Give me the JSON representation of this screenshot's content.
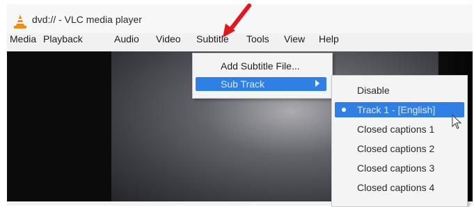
{
  "window": {
    "title": "dvd:// - VLC media player",
    "icon": "vlc-cone-icon"
  },
  "menubar": {
    "items": [
      {
        "label": "Media"
      },
      {
        "label": "Playback"
      },
      {
        "label": "Audio"
      },
      {
        "label": "Video"
      },
      {
        "label": "Subtitle"
      },
      {
        "label": "Tools"
      },
      {
        "label": "View"
      },
      {
        "label": "Help"
      }
    ]
  },
  "subtitle_menu": {
    "items": [
      {
        "label": "Add Subtitle File..."
      },
      {
        "label": "Sub Track",
        "highlighted": true,
        "has_submenu": true
      }
    ]
  },
  "sub_track_menu": {
    "items": [
      {
        "label": "Disable"
      },
      {
        "label": "Track 1 - [English]",
        "selected": true
      },
      {
        "label": "Closed captions 1"
      },
      {
        "label": "Closed captions 2"
      },
      {
        "label": "Closed captions 3"
      },
      {
        "label": "Closed captions 4"
      }
    ]
  },
  "colors": {
    "highlight": "#2f7fe4",
    "annotation_arrow": "#e3161b",
    "vlc_orange": "#f08a1c"
  }
}
